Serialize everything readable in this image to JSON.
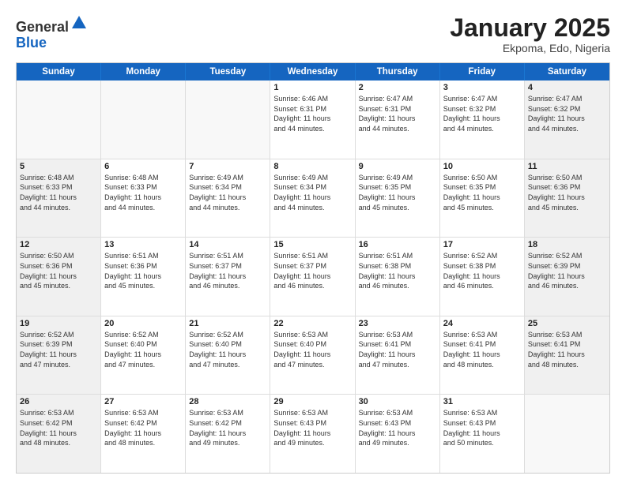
{
  "logo": {
    "general": "General",
    "blue": "Blue"
  },
  "header": {
    "title": "January 2025",
    "location": "Ekpoma, Edo, Nigeria"
  },
  "weekdays": [
    "Sunday",
    "Monday",
    "Tuesday",
    "Wednesday",
    "Thursday",
    "Friday",
    "Saturday"
  ],
  "weeks": [
    [
      {
        "day": "",
        "info": "",
        "empty": true
      },
      {
        "day": "",
        "info": "",
        "empty": true
      },
      {
        "day": "",
        "info": "",
        "empty": true
      },
      {
        "day": "1",
        "info": "Sunrise: 6:46 AM\nSunset: 6:31 PM\nDaylight: 11 hours\nand 44 minutes.",
        "empty": false
      },
      {
        "day": "2",
        "info": "Sunrise: 6:47 AM\nSunset: 6:31 PM\nDaylight: 11 hours\nand 44 minutes.",
        "empty": false
      },
      {
        "day": "3",
        "info": "Sunrise: 6:47 AM\nSunset: 6:32 PM\nDaylight: 11 hours\nand 44 minutes.",
        "empty": false
      },
      {
        "day": "4",
        "info": "Sunrise: 6:47 AM\nSunset: 6:32 PM\nDaylight: 11 hours\nand 44 minutes.",
        "empty": false
      }
    ],
    [
      {
        "day": "5",
        "info": "Sunrise: 6:48 AM\nSunset: 6:33 PM\nDaylight: 11 hours\nand 44 minutes.",
        "empty": false
      },
      {
        "day": "6",
        "info": "Sunrise: 6:48 AM\nSunset: 6:33 PM\nDaylight: 11 hours\nand 44 minutes.",
        "empty": false
      },
      {
        "day": "7",
        "info": "Sunrise: 6:49 AM\nSunset: 6:34 PM\nDaylight: 11 hours\nand 44 minutes.",
        "empty": false
      },
      {
        "day": "8",
        "info": "Sunrise: 6:49 AM\nSunset: 6:34 PM\nDaylight: 11 hours\nand 44 minutes.",
        "empty": false
      },
      {
        "day": "9",
        "info": "Sunrise: 6:49 AM\nSunset: 6:35 PM\nDaylight: 11 hours\nand 45 minutes.",
        "empty": false
      },
      {
        "day": "10",
        "info": "Sunrise: 6:50 AM\nSunset: 6:35 PM\nDaylight: 11 hours\nand 45 minutes.",
        "empty": false
      },
      {
        "day": "11",
        "info": "Sunrise: 6:50 AM\nSunset: 6:36 PM\nDaylight: 11 hours\nand 45 minutes.",
        "empty": false
      }
    ],
    [
      {
        "day": "12",
        "info": "Sunrise: 6:50 AM\nSunset: 6:36 PM\nDaylight: 11 hours\nand 45 minutes.",
        "empty": false
      },
      {
        "day": "13",
        "info": "Sunrise: 6:51 AM\nSunset: 6:36 PM\nDaylight: 11 hours\nand 45 minutes.",
        "empty": false
      },
      {
        "day": "14",
        "info": "Sunrise: 6:51 AM\nSunset: 6:37 PM\nDaylight: 11 hours\nand 46 minutes.",
        "empty": false
      },
      {
        "day": "15",
        "info": "Sunrise: 6:51 AM\nSunset: 6:37 PM\nDaylight: 11 hours\nand 46 minutes.",
        "empty": false
      },
      {
        "day": "16",
        "info": "Sunrise: 6:51 AM\nSunset: 6:38 PM\nDaylight: 11 hours\nand 46 minutes.",
        "empty": false
      },
      {
        "day": "17",
        "info": "Sunrise: 6:52 AM\nSunset: 6:38 PM\nDaylight: 11 hours\nand 46 minutes.",
        "empty": false
      },
      {
        "day": "18",
        "info": "Sunrise: 6:52 AM\nSunset: 6:39 PM\nDaylight: 11 hours\nand 46 minutes.",
        "empty": false
      }
    ],
    [
      {
        "day": "19",
        "info": "Sunrise: 6:52 AM\nSunset: 6:39 PM\nDaylight: 11 hours\nand 47 minutes.",
        "empty": false
      },
      {
        "day": "20",
        "info": "Sunrise: 6:52 AM\nSunset: 6:40 PM\nDaylight: 11 hours\nand 47 minutes.",
        "empty": false
      },
      {
        "day": "21",
        "info": "Sunrise: 6:52 AM\nSunset: 6:40 PM\nDaylight: 11 hours\nand 47 minutes.",
        "empty": false
      },
      {
        "day": "22",
        "info": "Sunrise: 6:53 AM\nSunset: 6:40 PM\nDaylight: 11 hours\nand 47 minutes.",
        "empty": false
      },
      {
        "day": "23",
        "info": "Sunrise: 6:53 AM\nSunset: 6:41 PM\nDaylight: 11 hours\nand 47 minutes.",
        "empty": false
      },
      {
        "day": "24",
        "info": "Sunrise: 6:53 AM\nSunset: 6:41 PM\nDaylight: 11 hours\nand 48 minutes.",
        "empty": false
      },
      {
        "day": "25",
        "info": "Sunrise: 6:53 AM\nSunset: 6:41 PM\nDaylight: 11 hours\nand 48 minutes.",
        "empty": false
      }
    ],
    [
      {
        "day": "26",
        "info": "Sunrise: 6:53 AM\nSunset: 6:42 PM\nDaylight: 11 hours\nand 48 minutes.",
        "empty": false
      },
      {
        "day": "27",
        "info": "Sunrise: 6:53 AM\nSunset: 6:42 PM\nDaylight: 11 hours\nand 48 minutes.",
        "empty": false
      },
      {
        "day": "28",
        "info": "Sunrise: 6:53 AM\nSunset: 6:42 PM\nDaylight: 11 hours\nand 49 minutes.",
        "empty": false
      },
      {
        "day": "29",
        "info": "Sunrise: 6:53 AM\nSunset: 6:43 PM\nDaylight: 11 hours\nand 49 minutes.",
        "empty": false
      },
      {
        "day": "30",
        "info": "Sunrise: 6:53 AM\nSunset: 6:43 PM\nDaylight: 11 hours\nand 49 minutes.",
        "empty": false
      },
      {
        "day": "31",
        "info": "Sunrise: 6:53 AM\nSunset: 6:43 PM\nDaylight: 11 hours\nand 50 minutes.",
        "empty": false
      },
      {
        "day": "",
        "info": "",
        "empty": true
      }
    ]
  ]
}
